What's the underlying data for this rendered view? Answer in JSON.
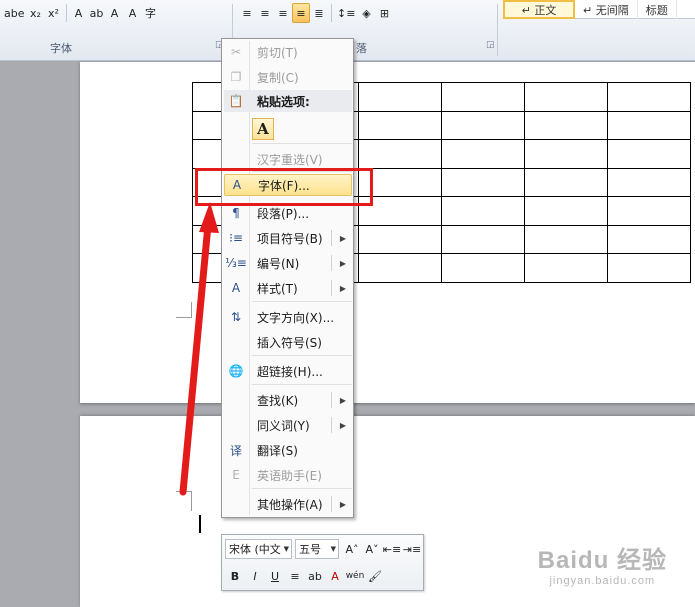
{
  "ribbon": {
    "font_group_label": "字体",
    "paragraph_group_label": "落",
    "font_buttons": [
      {
        "name": "strikethrough-button",
        "text": "abe"
      },
      {
        "name": "subscript-button",
        "text": "x₂"
      },
      {
        "name": "superscript-button",
        "text": "x²"
      },
      {
        "name": "text-effect-button",
        "text": "A"
      },
      {
        "name": "highlight-button",
        "text": "ab"
      },
      {
        "name": "font-color-button",
        "text": "A"
      },
      {
        "name": "char-shading-button",
        "text": "A"
      },
      {
        "name": "enclose-char-button",
        "text": "字"
      }
    ],
    "paragraph_buttons": [
      {
        "name": "align-left-button",
        "text": "≡"
      },
      {
        "name": "align-center-button",
        "text": "≡"
      },
      {
        "name": "align-right-button",
        "text": "≡"
      },
      {
        "name": "justify-button",
        "text": "≡"
      },
      {
        "name": "distributed-button",
        "text": "≣"
      },
      {
        "name": "line-spacing-button",
        "text": "↕≡"
      },
      {
        "name": "shading-button",
        "text": "◈"
      },
      {
        "name": "border-button",
        "text": "⊞"
      }
    ],
    "styles": [
      {
        "label": "↵ 正文",
        "selected": true
      },
      {
        "label": "↵ 无间隔",
        "selected": false
      },
      {
        "label": "标题",
        "selected": false
      }
    ]
  },
  "context_menu": {
    "items": [
      {
        "label": "剪切(T)",
        "icon": "scissors-icon",
        "glyph": "✂",
        "disabled": true,
        "submenu": false
      },
      {
        "label": "复制(C)",
        "icon": "copy-icon",
        "glyph": "❐",
        "disabled": true,
        "submenu": false
      },
      {
        "label": "粘贴选项:",
        "icon": "paste-icon",
        "glyph": "📋",
        "disabled": false,
        "submenu": false,
        "header": true
      },
      {
        "label": "汉字重选(V)",
        "icon": "reconvert-icon",
        "glyph": "",
        "disabled": true,
        "submenu": false
      },
      {
        "label": "字体(F)...",
        "icon": "font-icon",
        "glyph": "A",
        "disabled": false,
        "submenu": false,
        "highlighted": true
      },
      {
        "label": "段落(P)...",
        "icon": "paragraph-icon",
        "glyph": "¶",
        "disabled": false,
        "submenu": false
      },
      {
        "label": "项目符号(B)",
        "icon": "bullets-icon",
        "glyph": "⁝≡",
        "disabled": false,
        "submenu": true
      },
      {
        "label": "编号(N)",
        "icon": "numbering-icon",
        "glyph": "⅓≡",
        "disabled": false,
        "submenu": true
      },
      {
        "label": "样式(T)",
        "icon": "styles-icon",
        "glyph": "A",
        "disabled": false,
        "submenu": true
      },
      {
        "label": "文字方向(X)...",
        "icon": "text-direction-icon",
        "glyph": "⇅",
        "disabled": false,
        "submenu": false
      },
      {
        "label": "插入符号(S)",
        "icon": "insert-symbol-icon",
        "glyph": "",
        "disabled": false,
        "submenu": false
      },
      {
        "label": "超链接(H)...",
        "icon": "hyperlink-icon",
        "glyph": "🌐",
        "disabled": false,
        "submenu": false
      },
      {
        "label": "查找(K)",
        "icon": "find-icon",
        "glyph": "",
        "disabled": false,
        "submenu": true
      },
      {
        "label": "同义词(Y)",
        "icon": "synonyms-icon",
        "glyph": "",
        "disabled": false,
        "submenu": true
      },
      {
        "label": "翻译(S)",
        "icon": "translate-icon",
        "glyph": "译",
        "disabled": false,
        "submenu": false
      },
      {
        "label": "英语助手(E)",
        "icon": "english-assistant-icon",
        "glyph": "E",
        "disabled": true,
        "submenu": false
      },
      {
        "label": "其他操作(A)",
        "icon": "more-actions-icon",
        "glyph": "",
        "disabled": false,
        "submenu": true
      }
    ],
    "paste_option_label": "A"
  },
  "mini_toolbar": {
    "font_name": "宋体 (中文",
    "font_size": "五号",
    "row1_buttons": [
      {
        "name": "grow-font-button",
        "text": "A˄"
      },
      {
        "name": "shrink-font-button",
        "text": "A˅"
      },
      {
        "name": "decrease-indent-button",
        "text": "⇤≡"
      },
      {
        "name": "increase-indent-button",
        "text": "⇥≡"
      }
    ],
    "row2_buttons": [
      {
        "name": "bold-button",
        "text": "B"
      },
      {
        "name": "italic-button",
        "text": "I"
      },
      {
        "name": "underline-button",
        "text": "U"
      },
      {
        "name": "center-button",
        "text": "≡"
      },
      {
        "name": "mini-highlight-button",
        "text": "ab"
      },
      {
        "name": "mini-font-color-button",
        "text": "A"
      },
      {
        "name": "phonetic-guide-button",
        "text": "wén"
      },
      {
        "name": "format-painter-button",
        "text": "🖌"
      }
    ]
  },
  "watermark": {
    "brand": "Baidu 经验",
    "url": "jingyan.baidu.com"
  },
  "colors": {
    "annotation_red": "#e41b1b",
    "highlight_yellow": "#fde28d"
  }
}
